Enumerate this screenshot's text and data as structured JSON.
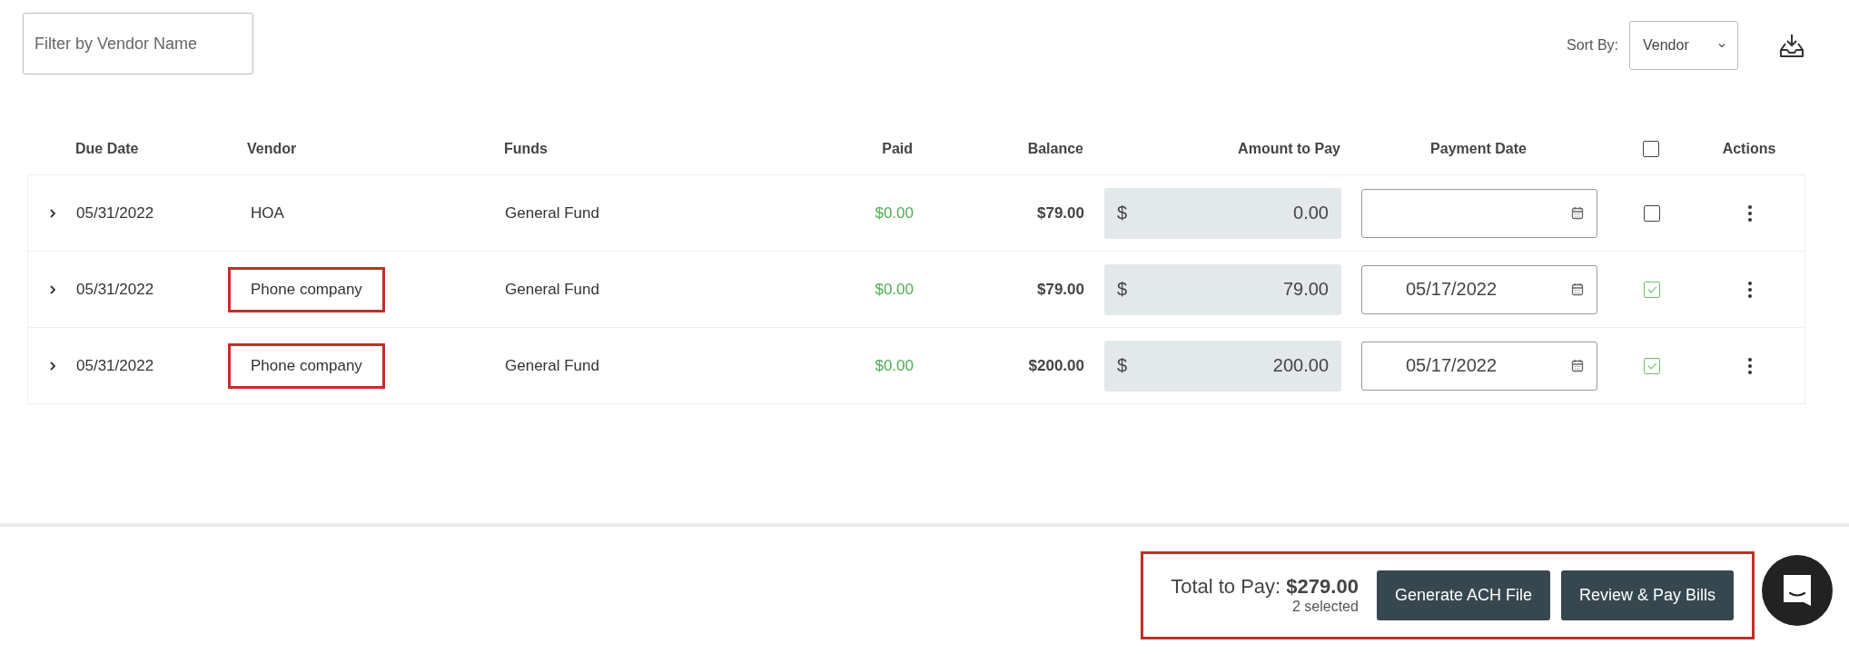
{
  "filter": {
    "placeholder": "Filter by Vendor Name"
  },
  "sort": {
    "label": "Sort By:",
    "value": "Vendor"
  },
  "table": {
    "columns": [
      "Due Date",
      "Vendor",
      "Funds",
      "Paid",
      "Balance",
      "Amount to Pay",
      "Payment Date",
      "Actions"
    ],
    "select_all_checked": false,
    "rows": [
      {
        "due_date": "05/31/2022",
        "vendor": "HOA",
        "vendor_highlighted": false,
        "funds": "General Fund",
        "paid": "$0.00",
        "balance": "$79.00",
        "currency": "$",
        "amount": "0.00",
        "payment_date": "",
        "checked": false
      },
      {
        "due_date": "05/31/2022",
        "vendor": "Phone company",
        "vendor_highlighted": true,
        "funds": "General Fund",
        "paid": "$0.00",
        "balance": "$79.00",
        "currency": "$",
        "amount": "79.00",
        "payment_date": "05/17/2022",
        "checked": true
      },
      {
        "due_date": "05/31/2022",
        "vendor": "Phone company",
        "vendor_highlighted": true,
        "funds": "General Fund",
        "paid": "$0.00",
        "balance": "$200.00",
        "currency": "$",
        "amount": "200.00",
        "payment_date": "05/17/2022",
        "checked": true
      }
    ]
  },
  "footer": {
    "highlighted": true,
    "total": "Total to Pay: **$279.00**",
    "selected_count": "2 selected",
    "buttons": [
      "Generate ACH File",
      "Review & Pay Bills"
    ]
  }
}
